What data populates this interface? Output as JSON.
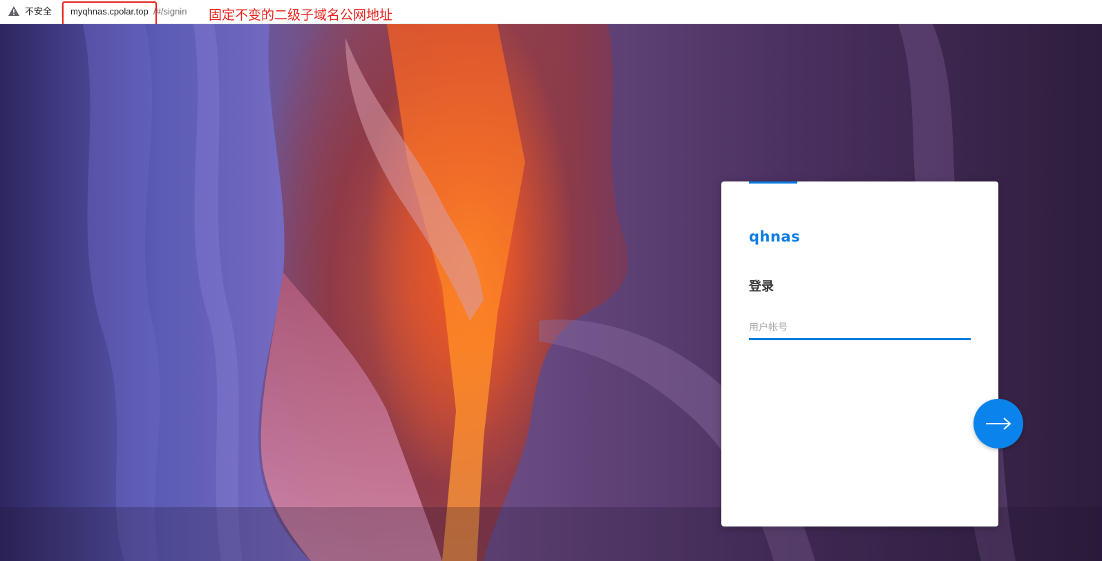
{
  "addressbar": {
    "insecure_label": "不安全",
    "url_host": "myqhnas.cpolar.top",
    "url_path": "/#/signin",
    "annotation": "固定不变的二级子域名公网地址",
    "annotation_color": "#e8221b"
  },
  "login": {
    "brand": "qhnas",
    "title": "登录",
    "username_placeholder": "用户帐号",
    "username_value": "",
    "submit_icon": "arrow-right-icon",
    "accent_color": "#0a7de2"
  }
}
